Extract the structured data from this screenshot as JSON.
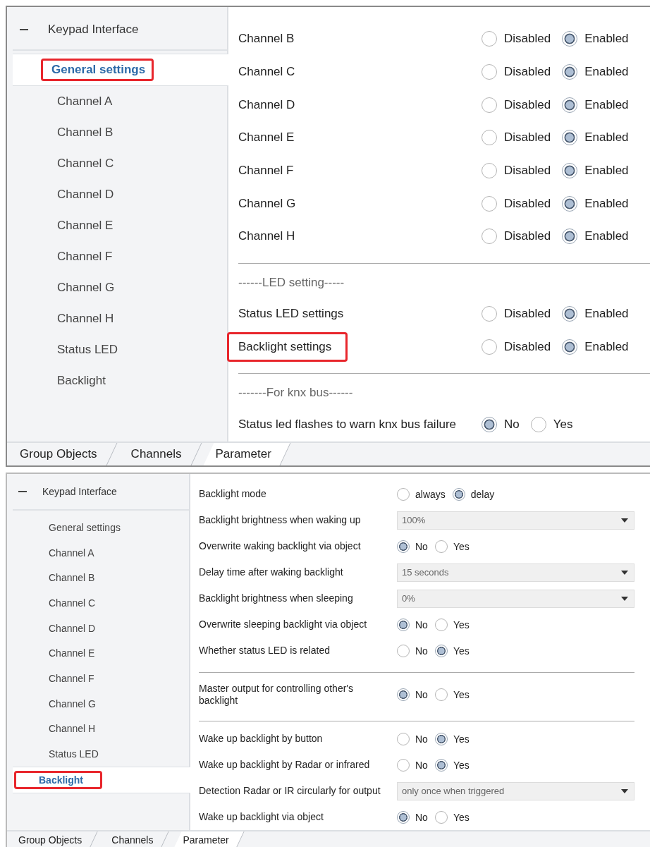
{
  "panels": [
    {
      "sidebar": {
        "header": "Keypad Interface",
        "items": [
          {
            "label": "General settings",
            "selected": true,
            "highlighted": true
          },
          {
            "label": "Channel A",
            "selected": false,
            "highlighted": false
          },
          {
            "label": "Channel B",
            "selected": false,
            "highlighted": false
          },
          {
            "label": "Channel C",
            "selected": false,
            "highlighted": false
          },
          {
            "label": "Channel D",
            "selected": false,
            "highlighted": false
          },
          {
            "label": "Channel E",
            "selected": false,
            "highlighted": false
          },
          {
            "label": "Channel F",
            "selected": false,
            "highlighted": false
          },
          {
            "label": "Channel G",
            "selected": false,
            "highlighted": false
          },
          {
            "label": "Channel H",
            "selected": false,
            "highlighted": false
          },
          {
            "label": "Status LED",
            "selected": false,
            "highlighted": false
          },
          {
            "label": "Backlight",
            "selected": false,
            "highlighted": false
          }
        ]
      },
      "rows": [
        {
          "kind": "radio",
          "label": "Channel B",
          "highlighted": false,
          "options": [
            {
              "label": "Disabled",
              "selected": false
            },
            {
              "label": "Enabled",
              "selected": true
            }
          ]
        },
        {
          "kind": "radio",
          "label": "Channel C",
          "highlighted": false,
          "options": [
            {
              "label": "Disabled",
              "selected": false
            },
            {
              "label": "Enabled",
              "selected": true
            }
          ]
        },
        {
          "kind": "radio",
          "label": "Channel D",
          "highlighted": false,
          "options": [
            {
              "label": "Disabled",
              "selected": false
            },
            {
              "label": "Enabled",
              "selected": true
            }
          ]
        },
        {
          "kind": "radio",
          "label": "Channel E",
          "highlighted": false,
          "options": [
            {
              "label": "Disabled",
              "selected": false
            },
            {
              "label": "Enabled",
              "selected": true
            }
          ]
        },
        {
          "kind": "radio",
          "label": "Channel F",
          "highlighted": false,
          "options": [
            {
              "label": "Disabled",
              "selected": false
            },
            {
              "label": "Enabled",
              "selected": true
            }
          ]
        },
        {
          "kind": "radio",
          "label": "Channel G",
          "highlighted": false,
          "options": [
            {
              "label": "Disabled",
              "selected": false
            },
            {
              "label": "Enabled",
              "selected": true
            }
          ]
        },
        {
          "kind": "radio",
          "label": "Channel H",
          "highlighted": false,
          "options": [
            {
              "label": "Disabled",
              "selected": false
            },
            {
              "label": "Enabled",
              "selected": true
            }
          ]
        },
        {
          "kind": "separator"
        },
        {
          "kind": "heading",
          "text": "------LED setting-----"
        },
        {
          "kind": "radio",
          "label": "Status LED settings",
          "highlighted": false,
          "options": [
            {
              "label": "Disabled",
              "selected": false
            },
            {
              "label": "Enabled",
              "selected": true
            }
          ]
        },
        {
          "kind": "radio",
          "label": "Backlight settings",
          "highlighted": true,
          "options": [
            {
              "label": "Disabled",
              "selected": false
            },
            {
              "label": "Enabled",
              "selected": true
            }
          ]
        },
        {
          "kind": "separator"
        },
        {
          "kind": "heading",
          "text": "-------For knx bus------"
        },
        {
          "kind": "radio",
          "label": "Status led flashes to warn knx bus failure",
          "highlighted": false,
          "options": [
            {
              "label": "No",
              "selected": true
            },
            {
              "label": "Yes",
              "selected": false
            }
          ]
        }
      ],
      "tabs": [
        {
          "label": "Group Objects",
          "selected": false
        },
        {
          "label": "Channels",
          "selected": false
        },
        {
          "label": "Parameter",
          "selected": true
        }
      ]
    },
    {
      "sidebar": {
        "header": "Keypad Interface",
        "items": [
          {
            "label": "General settings",
            "selected": false,
            "highlighted": false
          },
          {
            "label": "Channel A",
            "selected": false,
            "highlighted": false
          },
          {
            "label": "Channel B",
            "selected": false,
            "highlighted": false
          },
          {
            "label": "Channel C",
            "selected": false,
            "highlighted": false
          },
          {
            "label": "Channel D",
            "selected": false,
            "highlighted": false
          },
          {
            "label": "Channel E",
            "selected": false,
            "highlighted": false
          },
          {
            "label": "Channel F",
            "selected": false,
            "highlighted": false
          },
          {
            "label": "Channel G",
            "selected": false,
            "highlighted": false
          },
          {
            "label": "Channel H",
            "selected": false,
            "highlighted": false
          },
          {
            "label": "Status LED",
            "selected": false,
            "highlighted": false
          },
          {
            "label": "Backlight",
            "selected": true,
            "highlighted": true
          }
        ]
      },
      "rows": [
        {
          "kind": "radio",
          "label": "Backlight mode",
          "highlighted": false,
          "options": [
            {
              "label": "always",
              "selected": false
            },
            {
              "label": "delay",
              "selected": true
            }
          ]
        },
        {
          "kind": "select",
          "label": "Backlight brightness when waking up",
          "highlighted": false,
          "value": "100%"
        },
        {
          "kind": "radio",
          "label": "Overwrite waking backlight via object",
          "highlighted": false,
          "options": [
            {
              "label": "No",
              "selected": true
            },
            {
              "label": "Yes",
              "selected": false
            }
          ]
        },
        {
          "kind": "select",
          "label": "Delay time after waking backlight",
          "highlighted": false,
          "value": "15 seconds"
        },
        {
          "kind": "select",
          "label": "Backlight brightness when sleeping",
          "highlighted": false,
          "value": "0%"
        },
        {
          "kind": "radio",
          "label": "Overwrite sleeping backlight via object",
          "highlighted": false,
          "options": [
            {
              "label": "No",
              "selected": true
            },
            {
              "label": "Yes",
              "selected": false
            }
          ]
        },
        {
          "kind": "radio",
          "label": "Whether status LED is related",
          "highlighted": false,
          "options": [
            {
              "label": "No",
              "selected": false
            },
            {
              "label": "Yes",
              "selected": true
            }
          ]
        },
        {
          "kind": "separator"
        },
        {
          "kind": "radio",
          "label": "Master output for controlling other's backlight",
          "highlighted": false,
          "options": [
            {
              "label": "No",
              "selected": true
            },
            {
              "label": "Yes",
              "selected": false
            }
          ]
        },
        {
          "kind": "separator"
        },
        {
          "kind": "radio",
          "label": "Wake up backlight by button",
          "highlighted": false,
          "options": [
            {
              "label": "No",
              "selected": false
            },
            {
              "label": "Yes",
              "selected": true
            }
          ]
        },
        {
          "kind": "radio",
          "label": "Wake up backlight by Radar or infrared",
          "highlighted": false,
          "options": [
            {
              "label": "No",
              "selected": false
            },
            {
              "label": "Yes",
              "selected": true
            }
          ]
        },
        {
          "kind": "select",
          "label": "Detection Radar or IR circularly for output",
          "highlighted": false,
          "value": "only once when triggered"
        },
        {
          "kind": "radio",
          "label": "Wake up backlight via object",
          "highlighted": false,
          "options": [
            {
              "label": "No",
              "selected": true
            },
            {
              "label": "Yes",
              "selected": false
            }
          ]
        }
      ],
      "tabs": [
        {
          "label": "Group Objects",
          "selected": false
        },
        {
          "label": "Channels",
          "selected": false
        },
        {
          "label": "Parameter",
          "selected": true
        }
      ]
    }
  ]
}
